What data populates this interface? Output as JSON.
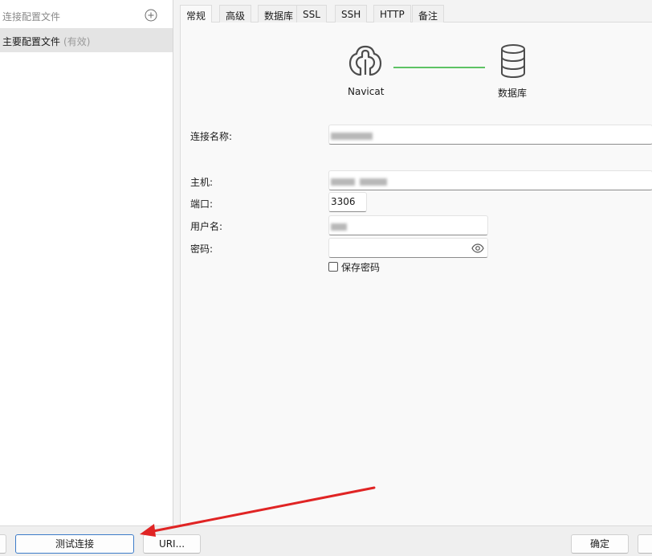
{
  "sidebar": {
    "header_placeholder": "连接配置文件",
    "add_icon": "plus-circle-icon",
    "profile": {
      "name": "主要配置文件",
      "status": "(有效)"
    }
  },
  "tabs": [
    {
      "label": "常规",
      "active": true
    },
    {
      "label": "高级"
    },
    {
      "label": "数据库"
    },
    {
      "label": "SSL"
    },
    {
      "label": "SSH"
    },
    {
      "label": "HTTP"
    },
    {
      "label": "备注"
    }
  ],
  "diagram": {
    "left_label": "Navicat",
    "right_label": "数据库",
    "connector_color": "#5ec364"
  },
  "form": {
    "connection_name_label": "连接名称:",
    "host_label": "主机:",
    "port_label": "端口:",
    "port_value": "3306",
    "username_label": "用户名:",
    "password_label": "密码:",
    "save_password_label": "保存密码"
  },
  "buttons": {
    "test_connection": "测试连接",
    "uri": "URI...",
    "ok": "确定"
  },
  "colors": {
    "annotation_arrow": "#e02424",
    "test_button_border": "#3d7cc9"
  }
}
